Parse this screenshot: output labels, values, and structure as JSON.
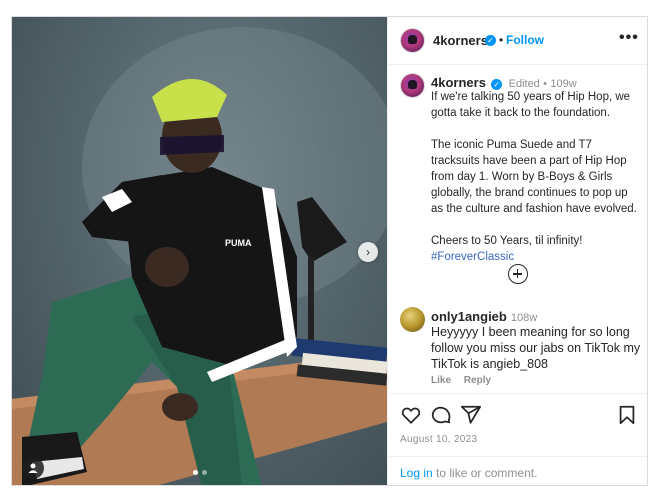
{
  "post": {
    "author": {
      "username": "4korners",
      "verified_icon": "verified-badge-icon",
      "follow_label": "Follow",
      "separator": "•"
    },
    "more_icon": "more-options-icon",
    "more_glyph": "•••",
    "media": {
      "next_glyph": "›",
      "carousel_slides": 2,
      "carousel_active_index": 0
    },
    "caption": {
      "username": "4korners",
      "edited": "Edited",
      "separator": "•",
      "age": "109w",
      "paragraphs": [
        "If we're talking 50 years of Hip Hop, we gotta take it back to the foundation.",
        "The iconic Puma Suede and T7 tracksuits have been a part of Hip Hop from day 1. Worn by B-Boys & Girls globally, the brand continues to pop up as the culture and fashion have evolved.",
        "Cheers to 50 Years, til infinity!"
      ],
      "hashtag": "#ForeverClassic"
    },
    "load_more_icon": "plus-circle-icon",
    "comment": {
      "username": "only1angieb",
      "age": "108w",
      "text": "Heyyyyy I been meaning for so long follow you miss our jabs on TikTok my TikTok is angieb_808",
      "like_label": "Like",
      "reply_label": "Reply"
    },
    "actions": {
      "icons": [
        "heart-icon",
        "comment-icon",
        "share-icon",
        "bookmark-icon"
      ]
    },
    "date": "August 10, 2023",
    "login": {
      "link_text": "Log in",
      "rest_text": " to like or comment."
    },
    "colors": {
      "link_blue": "#0095f6",
      "hashtag_blue": "#3866c6",
      "text": "#262626",
      "muted": "#8e8e8e",
      "border": "#dbdbdb"
    }
  }
}
